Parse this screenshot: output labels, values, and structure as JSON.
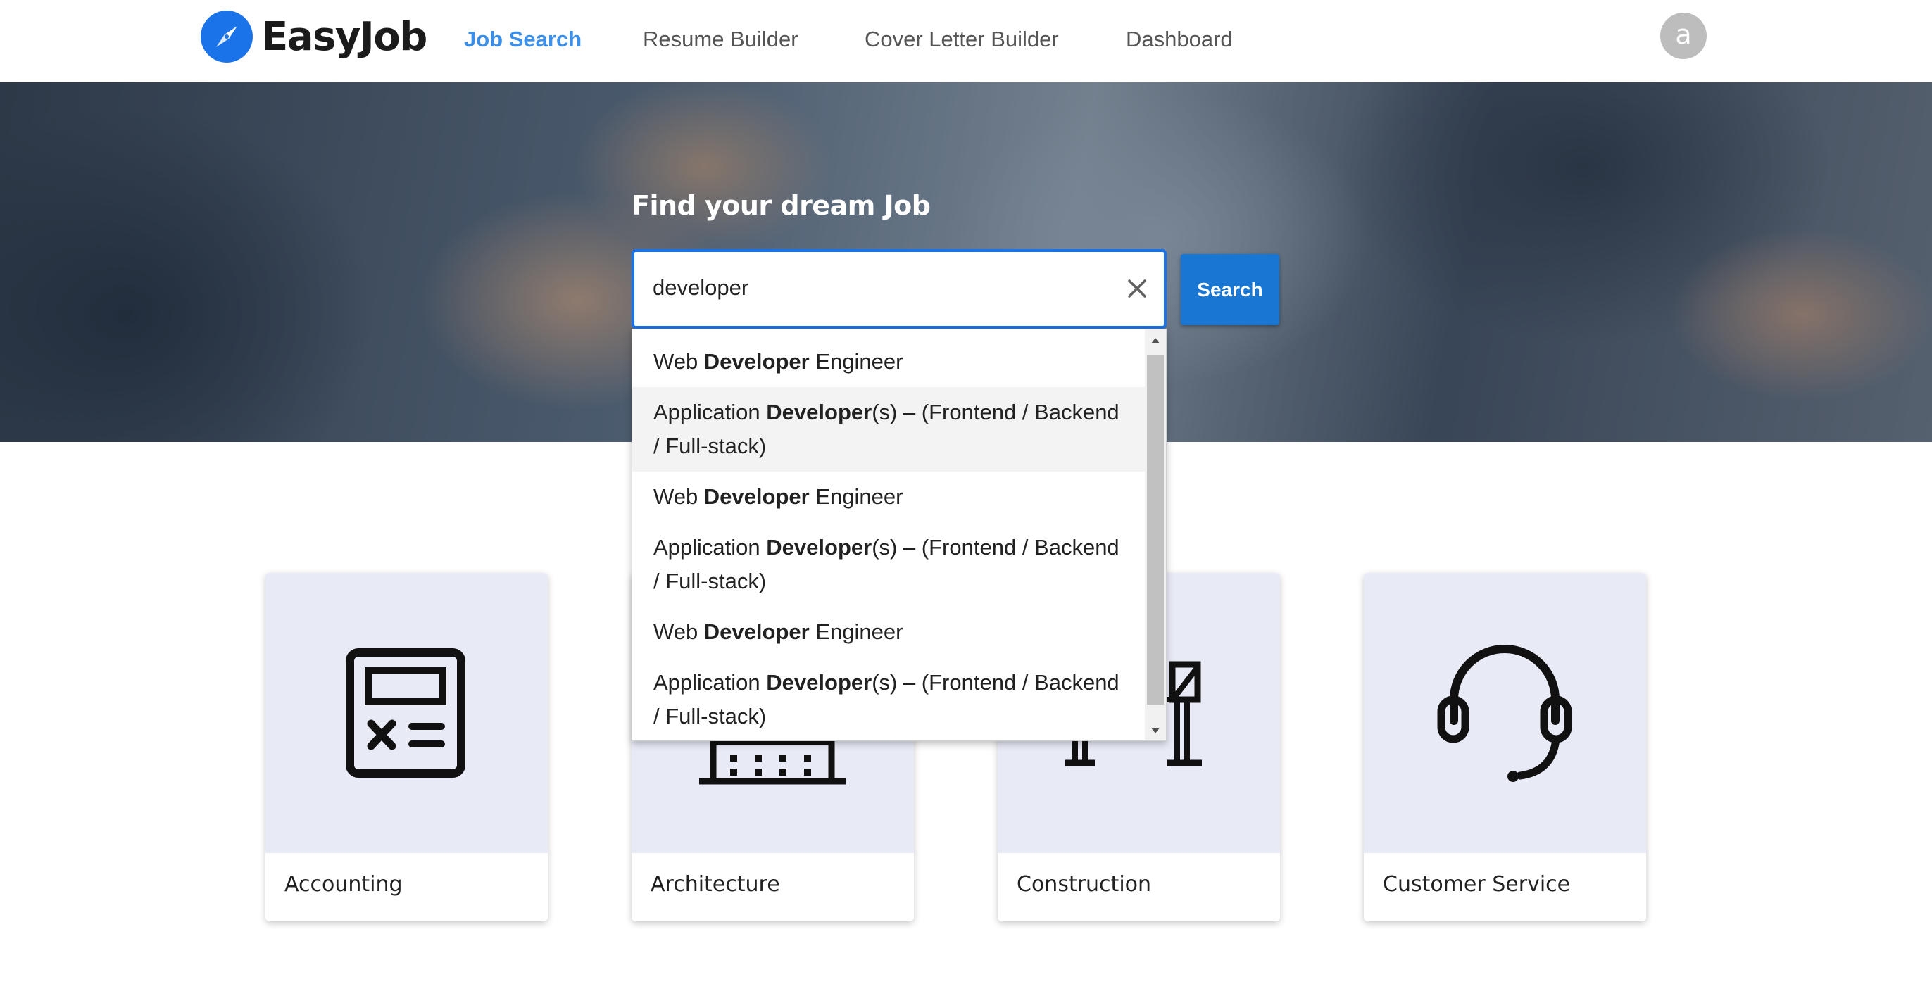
{
  "app": {
    "name": "EasyJob"
  },
  "nav": {
    "items": [
      {
        "label": "Job Search",
        "active": true
      },
      {
        "label": "Resume Builder",
        "active": false
      },
      {
        "label": "Cover Letter Builder",
        "active": false
      },
      {
        "label": "Dashboard",
        "active": false
      }
    ]
  },
  "user": {
    "avatar_initial": "a"
  },
  "hero": {
    "title": "Find your dream Job",
    "search_value": "developer",
    "search_button": "Search",
    "clear_icon": "close-icon"
  },
  "suggestions": [
    {
      "prefix": "Web ",
      "match": "Developer",
      "suffix": " Engineer",
      "lines": 1,
      "highlighted": false
    },
    {
      "prefix": "Application ",
      "match": "Developer",
      "suffix": "(s) – (Frontend / Backend / Full-stack)",
      "lines": 2,
      "highlighted": true
    },
    {
      "prefix": "Web ",
      "match": "Developer",
      "suffix": " Engineer",
      "lines": 1,
      "highlighted": false
    },
    {
      "prefix": "Application ",
      "match": "Developer",
      "suffix": "(s) – (Frontend / Backend / Full-stack)",
      "lines": 2,
      "highlighted": false
    },
    {
      "prefix": "Web ",
      "match": "Developer",
      "suffix": " Engineer",
      "lines": 1,
      "highlighted": false
    },
    {
      "prefix": "Application ",
      "match": "Developer",
      "suffix": "(s) – (Frontend / Backend / Full-stack)",
      "lines": 2,
      "highlighted": false
    }
  ],
  "categories": [
    {
      "label": "Accounting",
      "icon": "calculator-icon"
    },
    {
      "label": "Architecture",
      "icon": "building-icon"
    },
    {
      "label": "Construction",
      "icon": "crane-icon"
    },
    {
      "label": "Customer Service",
      "icon": "headset-icon"
    }
  ],
  "colors": {
    "primary": "#1976d2",
    "nav_active": "#3b8fe8",
    "card_image_bg": "#e8eaf6"
  }
}
